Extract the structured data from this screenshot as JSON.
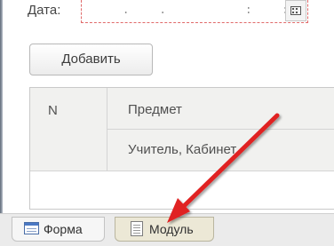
{
  "form": {
    "date_label": "Дата:",
    "date_mask": " .  .      :  :"
  },
  "toolbar": {
    "add_label": "Добавить"
  },
  "table": {
    "columns": {
      "n": "N",
      "subject": "Предмет",
      "teacher_room": "Учитель, Кабинет"
    }
  },
  "tabs": [
    {
      "label": "Форма",
      "icon": "form-icon",
      "active": false
    },
    {
      "label": "Модуль",
      "icon": "module-icon",
      "active": true
    }
  ],
  "annotation": {
    "arrow_color": "#e02020"
  }
}
